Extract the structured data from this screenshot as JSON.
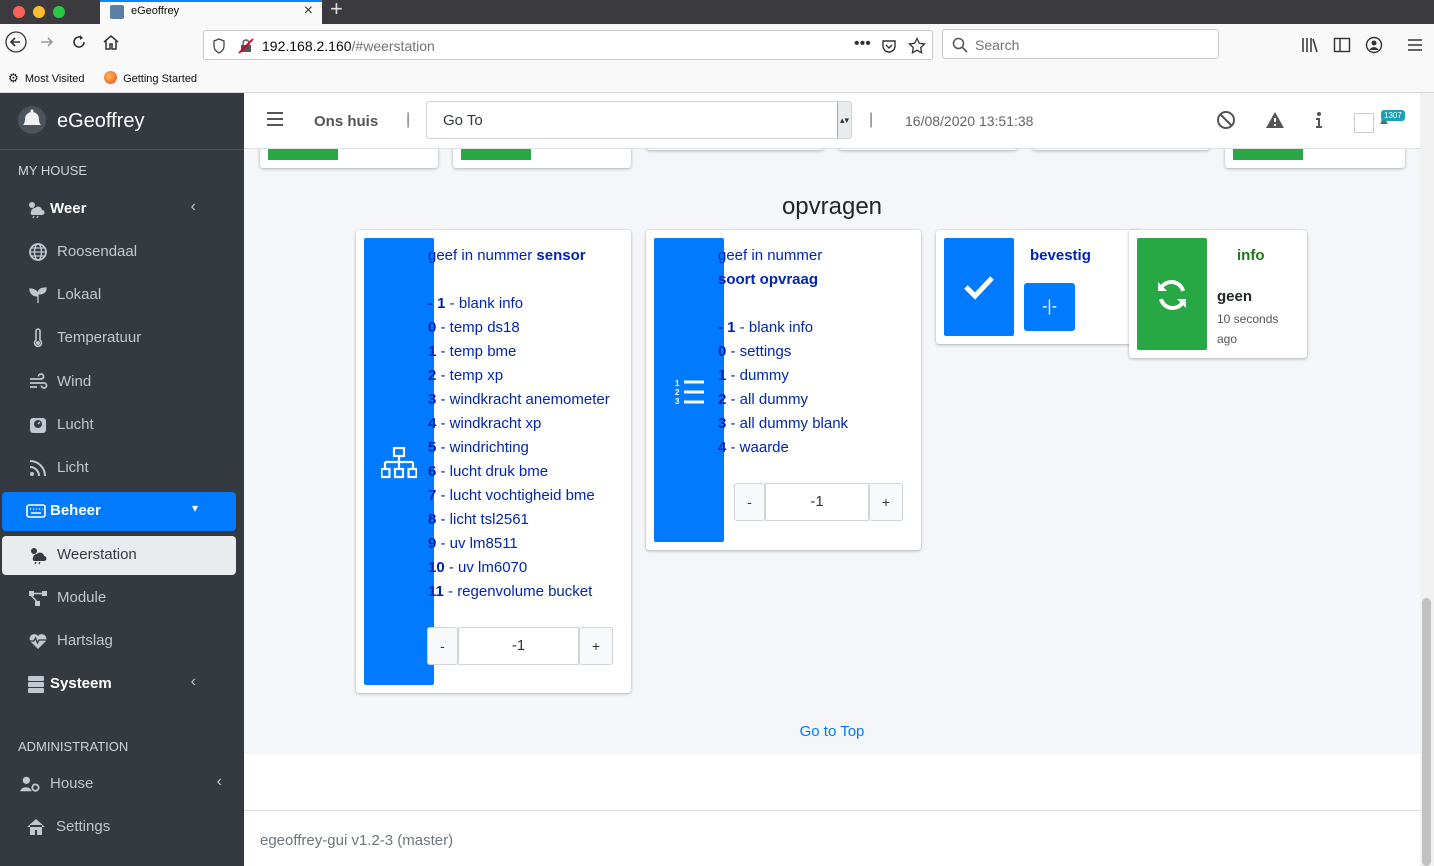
{
  "browser": {
    "tab_title": "eGeoffrey",
    "url_host": "192.168.2.160",
    "url_path": "/#weerstation",
    "search_placeholder": "Search",
    "bookmarks": [
      "Most Visited",
      "Getting Started"
    ]
  },
  "sidebar": {
    "brand": "eGeoffrey",
    "header_house": "MY HOUSE",
    "header_admin": "ADMINISTRATION",
    "items": {
      "weer": "Weer",
      "roosendaal": "Roosendaal",
      "lokaal": "Lokaal",
      "temperatuur": "Temperatuur",
      "wind": "Wind",
      "lucht": "Lucht",
      "licht": "Licht",
      "beheer": "Beheer",
      "weerstation": "Weerstation",
      "module": "Module",
      "hartslag": "Hartslag",
      "systeem": "Systeem",
      "house": "House",
      "settings": "Settings"
    }
  },
  "topnav": {
    "house_name": "Ons huis",
    "separator": "|",
    "goto_value": "Go To",
    "datetime": "16/08/2020 13:51:38",
    "badge_count": "1307"
  },
  "section": {
    "title": "opvragen"
  },
  "sensor_card": {
    "label_prefix": "geef in nummer",
    "label_bold": "sensor",
    "options": [
      {
        "num": "- 1",
        "text": " - blank info"
      },
      {
        "num": "0",
        "text": " - temp ds18"
      },
      {
        "num": "1",
        "text": " - temp bme"
      },
      {
        "num": "2",
        "text": " - temp xp"
      },
      {
        "num": "3",
        "text": " - windkracht anemometer"
      },
      {
        "num": "4",
        "text": " - windkracht xp"
      },
      {
        "num": "5",
        "text": " - windrichting"
      },
      {
        "num": "6",
        "text": " - lucht druk bme"
      },
      {
        "num": "7",
        "text": " - lucht vochtigheid bme"
      },
      {
        "num": "8",
        "text": " - licht tsl2561"
      },
      {
        "num": "9",
        "text": " - uv lm8511"
      },
      {
        "num": "10",
        "text": " - uv lm6070"
      },
      {
        "num": "11",
        "text": " - regenvolume bucket"
      }
    ],
    "minus": "-",
    "value": "-1",
    "plus": "+"
  },
  "query_card": {
    "label_prefix": "geef in nummer",
    "label_bold": "soort opvraag",
    "options": [
      {
        "num": "- 1",
        "text": " - blank info"
      },
      {
        "num": "0",
        "text": " - settings"
      },
      {
        "num": "1",
        "text": " - dummy"
      },
      {
        "num": "2",
        "text": " - all dummy"
      },
      {
        "num": "3",
        "text": " - all dummy blank"
      },
      {
        "num": "4",
        "text": " - waarde"
      }
    ],
    "minus": "-",
    "value": "-1",
    "plus": "+"
  },
  "confirm_card": {
    "title": "bevestig",
    "button_symbol": "-|-"
  },
  "info_card": {
    "title": "info",
    "value": "geen",
    "time": "10 seconds ago"
  },
  "footer": {
    "go_to_top": "Go to Top",
    "version": "egeoffrey-gui v1.2-3 (master)"
  },
  "colors": {
    "primary": "#007bff",
    "success": "#28a745",
    "sidebar_bg": "#343a40",
    "text_blue": "#0025b0"
  }
}
